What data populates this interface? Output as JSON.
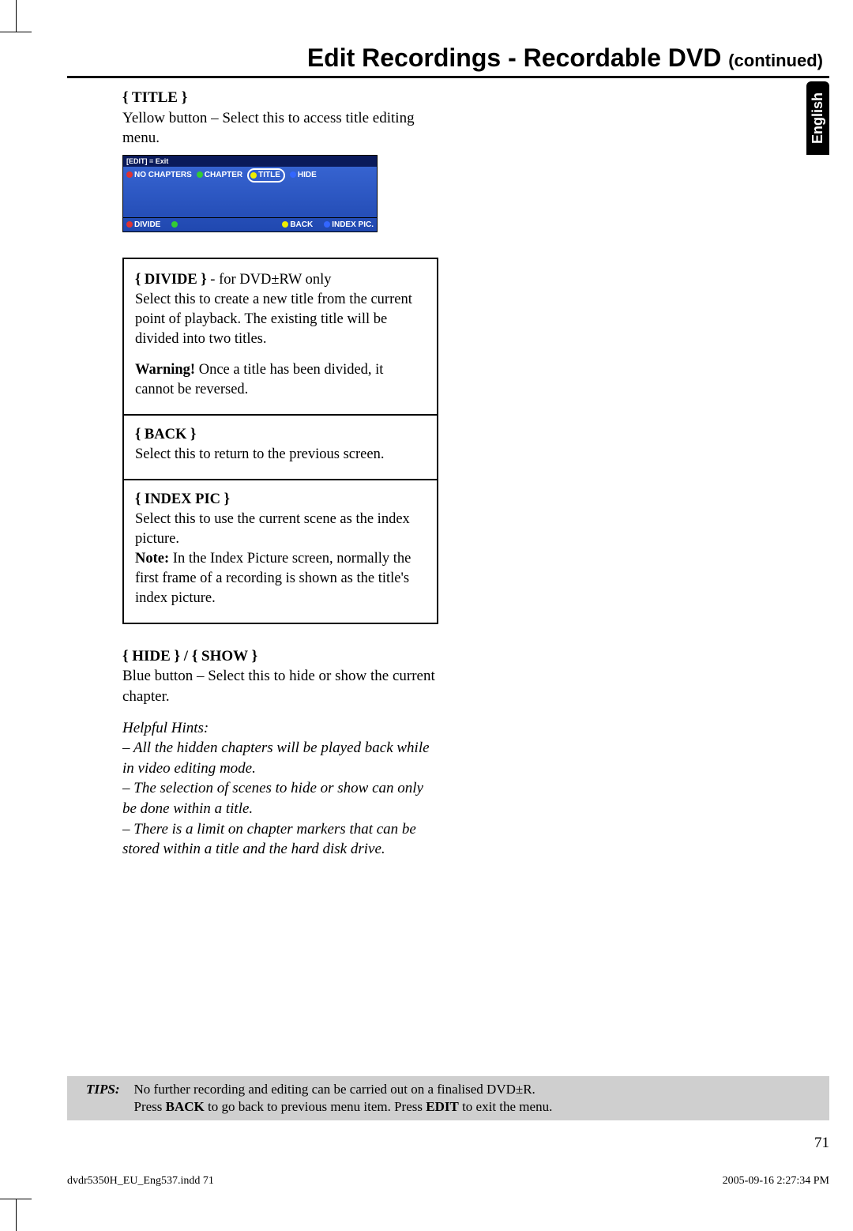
{
  "header": {
    "title": "Edit Recordings - Recordable DVD",
    "cont": "(continued)"
  },
  "lang": "English",
  "title_section": {
    "label": "{ TITLE }",
    "desc": "Yellow button – Select this to access title editing menu."
  },
  "osd": {
    "top": "[EDIT] = Exit",
    "mid": {
      "a": "NO CHAPTERS",
      "b": "CHAPTER",
      "c": "TITLE",
      "d": "HIDE"
    },
    "bot": {
      "a": "DIVIDE",
      "b": "BACK",
      "c": "INDEX PIC."
    }
  },
  "box": {
    "divide": {
      "label": "{ DIVIDE }",
      "suffix": " - for DVD±RW only",
      "p1": "Select this to create a new title from the current point of playback. The existing title will be divided into two titles.",
      "warn_label": "Warning!",
      "warn": " Once a title has been divided, it cannot be reversed."
    },
    "back": {
      "label": "{ BACK }",
      "p": "Select this to return to the previous screen."
    },
    "index": {
      "label": "{ INDEX PIC }",
      "p1": "Select this to use the current scene as the index picture.",
      "note_label": "Note:",
      "note": " In the Index Picture screen, normally the first frame of a recording is shown as the title's index picture."
    }
  },
  "hide": {
    "label": "{ HIDE } / { SHOW }",
    "desc": "Blue button – Select this to hide or show the current chapter.",
    "hints_title": "Helpful Hints:",
    "h1": "– All the hidden chapters will be played back while in video editing mode.",
    "h2": "– The selection of scenes to hide or show can only be done within a title.",
    "h3": "– There is a limit on chapter markers that can be stored within a title and the hard disk drive."
  },
  "tips": {
    "label": "TIPS:",
    "l1a": "No further recording and editing can be carried out on a finalised DVD±R.",
    "l2a": "Press ",
    "l2b": "BACK",
    "l2c": " to go back to previous menu item. Press ",
    "l2d": "EDIT",
    "l2e": " to exit the menu."
  },
  "page_number": "71",
  "footer": {
    "left": "dvdr5350H_EU_Eng537.indd   71",
    "right": "2005-09-16   2:27:34 PM"
  }
}
